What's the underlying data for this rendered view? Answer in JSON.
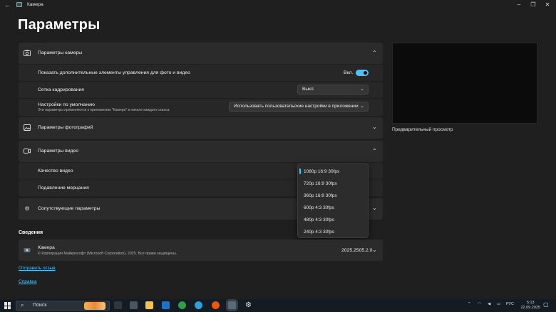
{
  "window": {
    "app_title": "Камера",
    "back_icon": "arrow-left-icon",
    "min_icon": "minimize-icon",
    "max_icon": "restore-icon",
    "close_icon": "close-icon"
  },
  "page": {
    "title": "Параметры"
  },
  "camera_settings": {
    "header": "Параметры камеры",
    "show_controls_label": "Показать дополнительные элементы управления для фото и видео",
    "show_controls_state": "Вкл.",
    "grid_label": "Сетка кадрирования",
    "grid_value": "Выкл.",
    "defaults_label": "Настройки по умолчанию",
    "defaults_desc": "Эти параметры применяются к приложению \"Камера\" в начале каждого сеанса",
    "defaults_value": "Использовать пользовательские настройки в приложении"
  },
  "photo_settings": {
    "header": "Параметры фотографий"
  },
  "video_settings": {
    "header": "Параметры видео",
    "quality_label": "Качество видео",
    "flicker_label": "Подавление мерцания"
  },
  "related_settings": {
    "header": "Сопутствующие параметры"
  },
  "quality_options": [
    "1080p 16:9 30fps",
    "720p 16:9 30fps",
    "360p 16:9 30fps",
    "600p 4:3 30fps",
    "480p 4:3 30fps",
    "240p 4:3 30fps"
  ],
  "quality_selected_index": 0,
  "preview": {
    "label": "Предварительный просмотр"
  },
  "about": {
    "header": "Сведения",
    "app_name": "Камера",
    "copyright": "© Корпорация Майкрософт (Microsoft Corporation), 2025. Все права защищены.",
    "version": "2025.2505.2.0"
  },
  "links": {
    "feedback": "Отправить отзыв",
    "help": "Справка"
  },
  "taskbar": {
    "search_placeholder": "Поиск",
    "language": "РУС",
    "time": "5:13",
    "date": "22.09.2025"
  },
  "colors": {
    "accent": "#4cc2ff",
    "background": "#1f1f1f",
    "card": "#2b2b2b",
    "taskbar": "#141b22"
  }
}
